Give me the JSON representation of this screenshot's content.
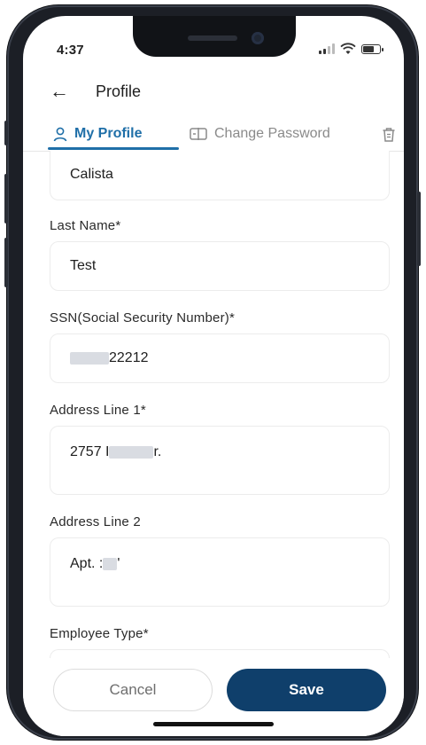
{
  "status_bar": {
    "time": "4:37"
  },
  "header": {
    "title": "Profile"
  },
  "tabs": [
    {
      "label": "My Profile"
    },
    {
      "label": "Change Password"
    },
    {
      "label": "D"
    }
  ],
  "form": {
    "first_name_value": "Calista",
    "last_name": {
      "label": "Last Name*",
      "value": "Test"
    },
    "ssn": {
      "label": "SSN(Social Security Number)*",
      "value_visible": "22212"
    },
    "address1": {
      "label": "Address Line 1*",
      "value_prefix": "2757 I",
      "value_suffix": "r."
    },
    "address2": {
      "label": "Address Line 2",
      "value_prefix": "Apt. :",
      "value_suffix": "'"
    },
    "employee_type": {
      "label": "Employee Type*"
    }
  },
  "actions": {
    "cancel_label": "Cancel",
    "save_label": "Save"
  },
  "colors": {
    "accent": "#1f6fa8",
    "primary_button": "#0f3f6b"
  }
}
